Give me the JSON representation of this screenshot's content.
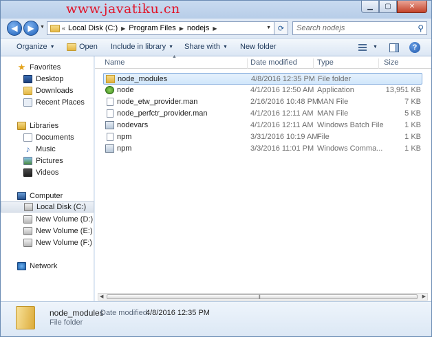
{
  "watermark": "www.javatiku.cn",
  "address": {
    "chevron": "«",
    "crumbs": [
      "Local Disk (C:)",
      "Program Files",
      "nodejs"
    ]
  },
  "search": {
    "placeholder": "Search nodejs"
  },
  "toolbar": {
    "organize": "Organize",
    "open": "Open",
    "include": "Include in library",
    "share": "Share with",
    "new_folder": "New folder"
  },
  "nav": {
    "favorites": "Favorites",
    "desktop": "Desktop",
    "downloads": "Downloads",
    "recent": "Recent Places",
    "libraries": "Libraries",
    "documents": "Documents",
    "music": "Music",
    "pictures": "Pictures",
    "videos": "Videos",
    "computer": "Computer",
    "local_disk": "Local Disk (C:)",
    "vol_e_top": "New Volume (D:)",
    "vol_e": "New Volume (E:)",
    "vol_f": "New Volume (F:)",
    "network": "Network"
  },
  "columns": {
    "name": "Name",
    "date": "Date modified",
    "type": "Type",
    "size": "Size"
  },
  "files": [
    {
      "name": "node_modules",
      "date": "4/8/2016 12:35 PM",
      "type": "File folder",
      "size": "",
      "icon": "folder-icon"
    },
    {
      "name": "node",
      "date": "4/1/2016 12:50 AM",
      "type": "Application",
      "size": "13,951 KB",
      "icon": "app-icon"
    },
    {
      "name": "node_etw_provider.man",
      "date": "2/16/2016 10:48 PM",
      "type": "MAN File",
      "size": "7 KB",
      "icon": "file-icon"
    },
    {
      "name": "node_perfctr_provider.man",
      "date": "4/1/2016 12:11 AM",
      "type": "MAN File",
      "size": "5 KB",
      "icon": "file-icon"
    },
    {
      "name": "nodevars",
      "date": "4/1/2016 12:11 AM",
      "type": "Windows Batch File",
      "size": "1 KB",
      "icon": "batch-file-icon"
    },
    {
      "name": "npm",
      "date": "3/31/2016 10:19 AM",
      "type": "File",
      "size": "1 KB",
      "icon": "file-icon"
    },
    {
      "name": "npm",
      "date": "3/3/2016 11:01 PM",
      "type": "Windows Comma...",
      "size": "1 KB",
      "icon": "batch-file-icon"
    }
  ],
  "details": {
    "name": "node_modules",
    "modified_label": "Date modified:",
    "modified_value": "4/8/2016 12:35 PM",
    "type": "File folder"
  }
}
